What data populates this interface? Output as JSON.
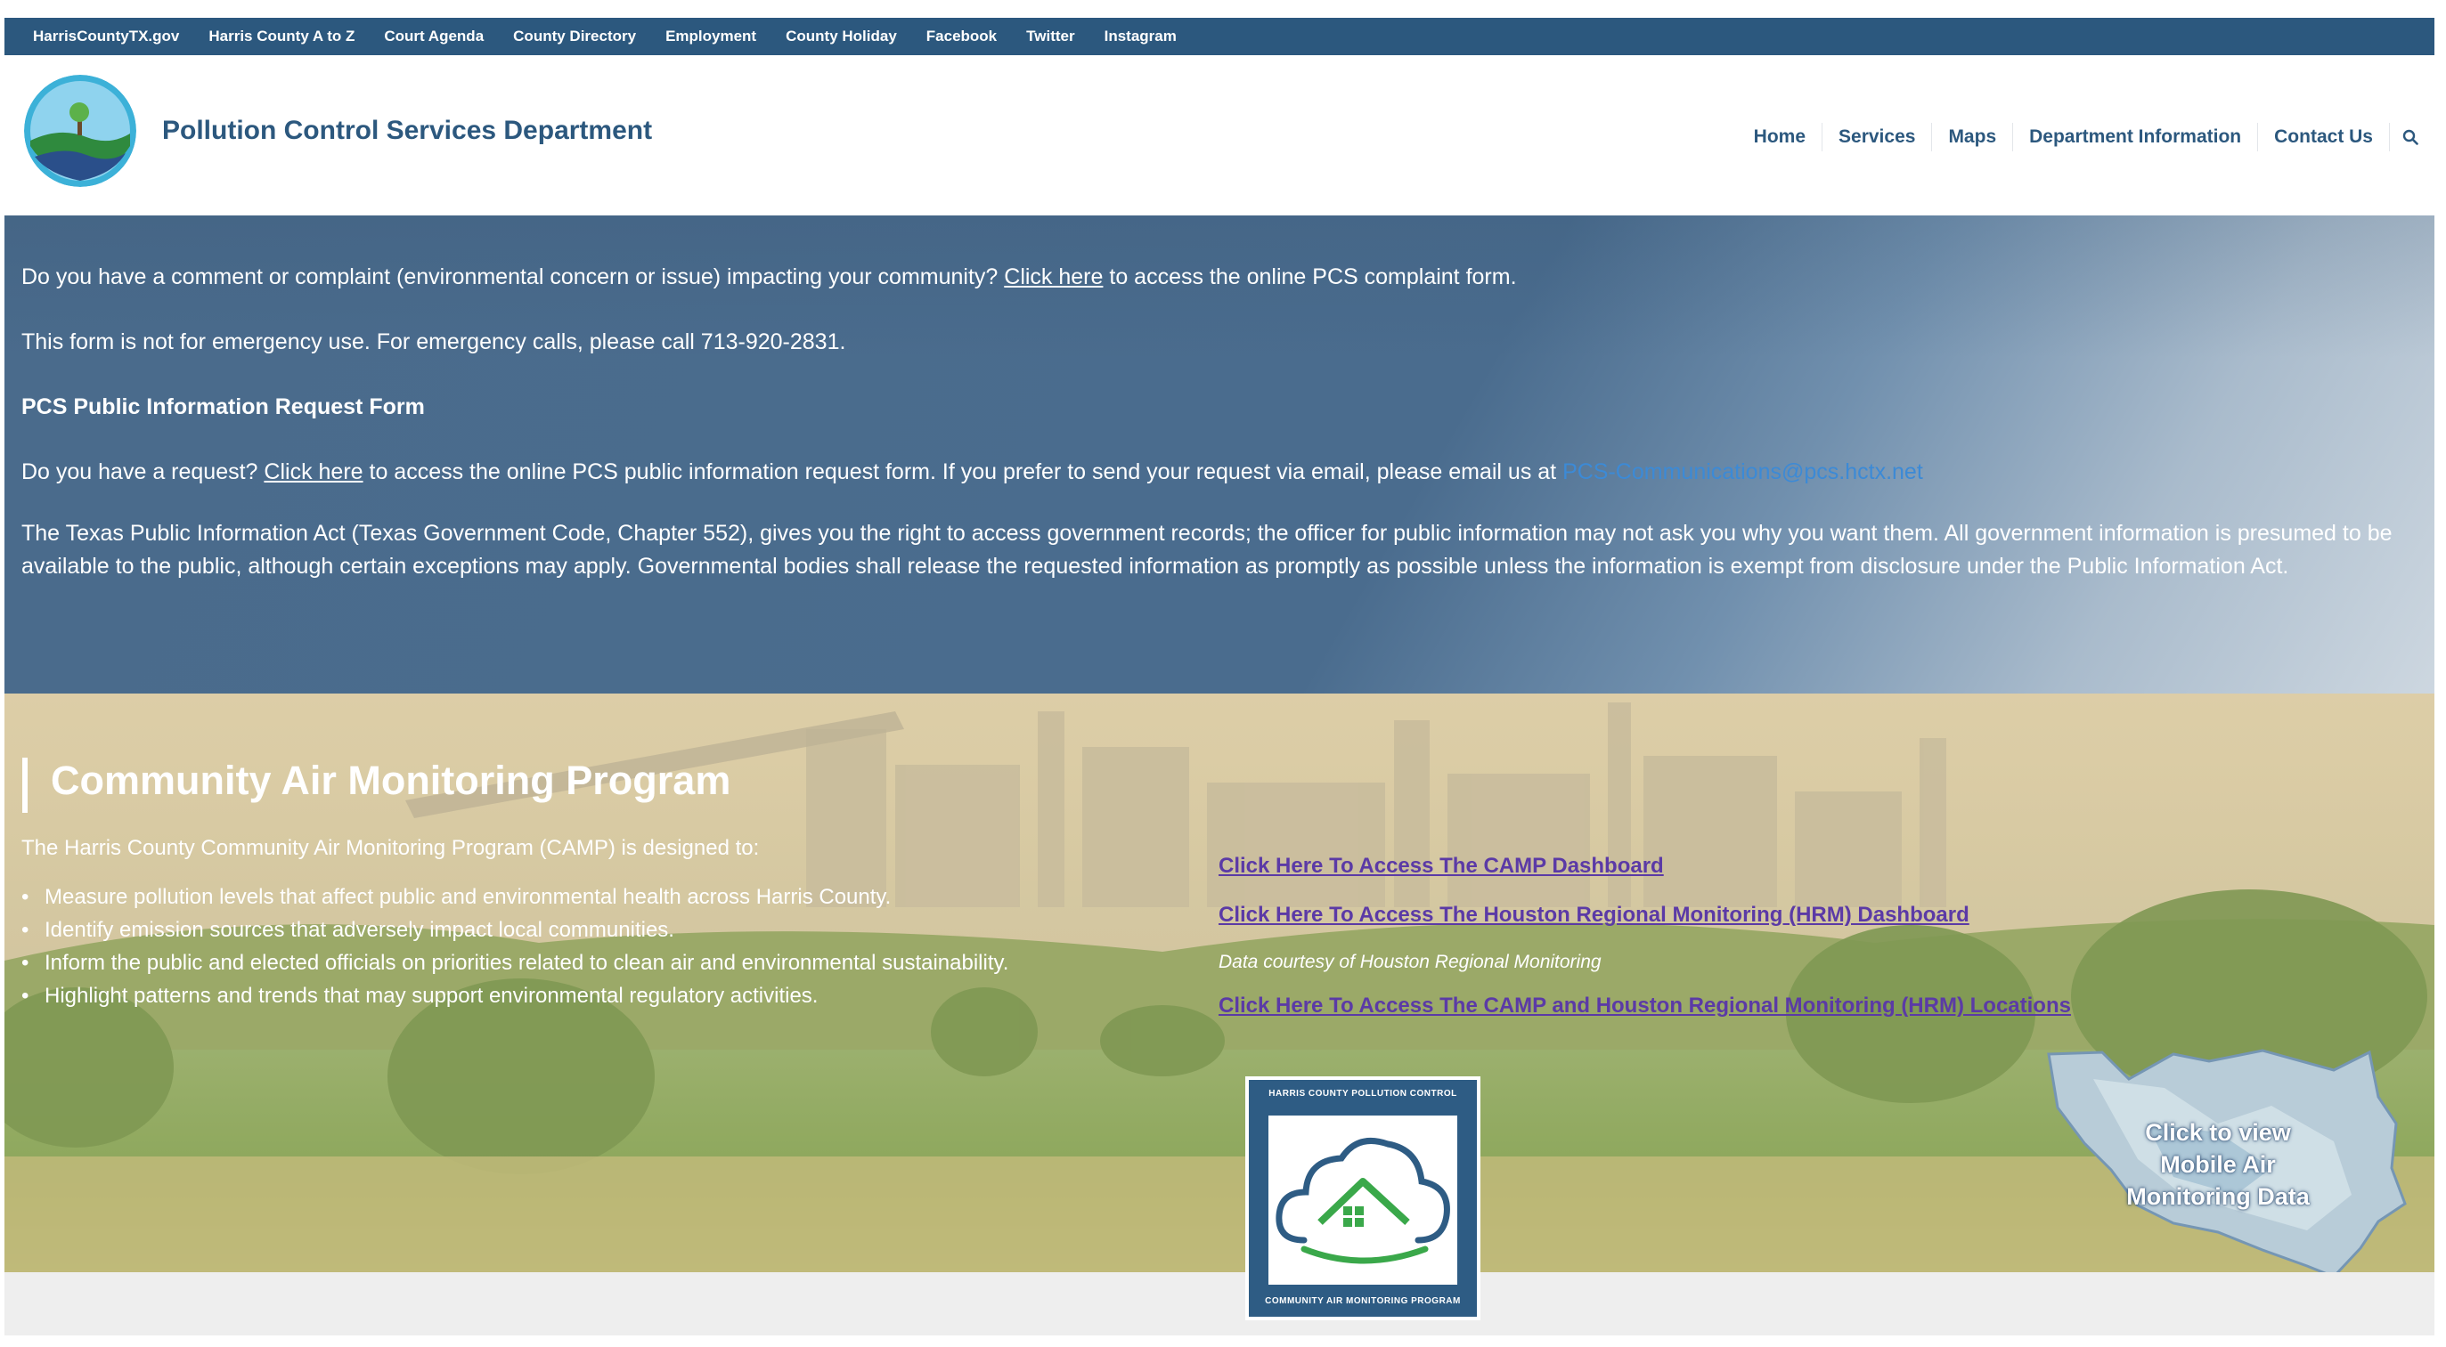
{
  "utility_nav": {
    "items": [
      "HarrisCountyTX.gov",
      "Harris County A to Z",
      "Court Agenda",
      "County Directory",
      "Employment",
      "County Holiday",
      "Facebook",
      "Twitter",
      "Instagram"
    ]
  },
  "header": {
    "title": "Pollution Control Services Department",
    "logo_icon": "department-logo-icon",
    "nav": [
      "Home",
      "Services",
      "Maps",
      "Department Information",
      "Contact Us"
    ],
    "search_icon": "search-icon"
  },
  "info": {
    "complaint": {
      "before": "Do you have a comment or complaint (environmental concern or issue) impacting your community? ",
      "link": "Click here",
      "after": " to access the online PCS complaint form."
    },
    "emergency": "This form is not for emergency use. For emergency calls, please call 713-920-2831.",
    "request_heading": "PCS Public Information Request Form",
    "request": {
      "before": "Do you have a request? ",
      "link": "Click here",
      "middle": " to access the online PCS public information request form. If you prefer to send your request via email, please email us at ",
      "email": "PCS-Communications@pcs.hctx.net"
    },
    "act": "The Texas Public Information Act (Texas Government Code, Chapter 552), gives you the right to access government records; the officer for public information may not ask you why you want them. All government information is presumed to be available to the public, although certain exceptions may apply. Governmental bodies shall release the requested information as promptly as possible unless the information is exempt from disclosure under the Public Information Act."
  },
  "camp": {
    "title": "Community Air Monitoring Program",
    "intro": "The Harris County Community Air Monitoring Program (CAMP) is designed to:",
    "bullets": [
      "Measure pollution levels that affect public and environmental health across Harris County.",
      "Identify emission sources that adversely impact local communities.",
      "Inform the public and elected officials on priorities related to clean air and environmental sustainability.",
      "Highlight patterns and trends that may support environmental regulatory activities."
    ],
    "links": {
      "dashboard": "Click Here To Access The CAMP Dashboard",
      "hrm_dashboard": "Click Here To Access The Houston Regional Monitoring (HRM) Dashboard",
      "courtesy": "Data courtesy of Houston Regional Monitoring",
      "locations": "Click Here To Access The CAMP and Houston Regional Monitoring (HRM) Locations"
    },
    "badge": {
      "top": "HARRIS COUNTY POLLUTION CONTROL",
      "bottom": "COMMUNITY AIR MONITORING PROGRAM",
      "icon": "cloud-house-icon"
    },
    "mobile_map": {
      "line1": "Click to view",
      "line2": "Mobile Air",
      "line3": "Monitoring Data",
      "icon": "harris-county-map-icon"
    }
  },
  "colors": {
    "utility_bar": "#2c587e",
    "brand_text": "#2c587e",
    "info_bg": "#4a6c8e",
    "camp_link": "#5b3aa6",
    "email_link": "#3c8ad6"
  }
}
